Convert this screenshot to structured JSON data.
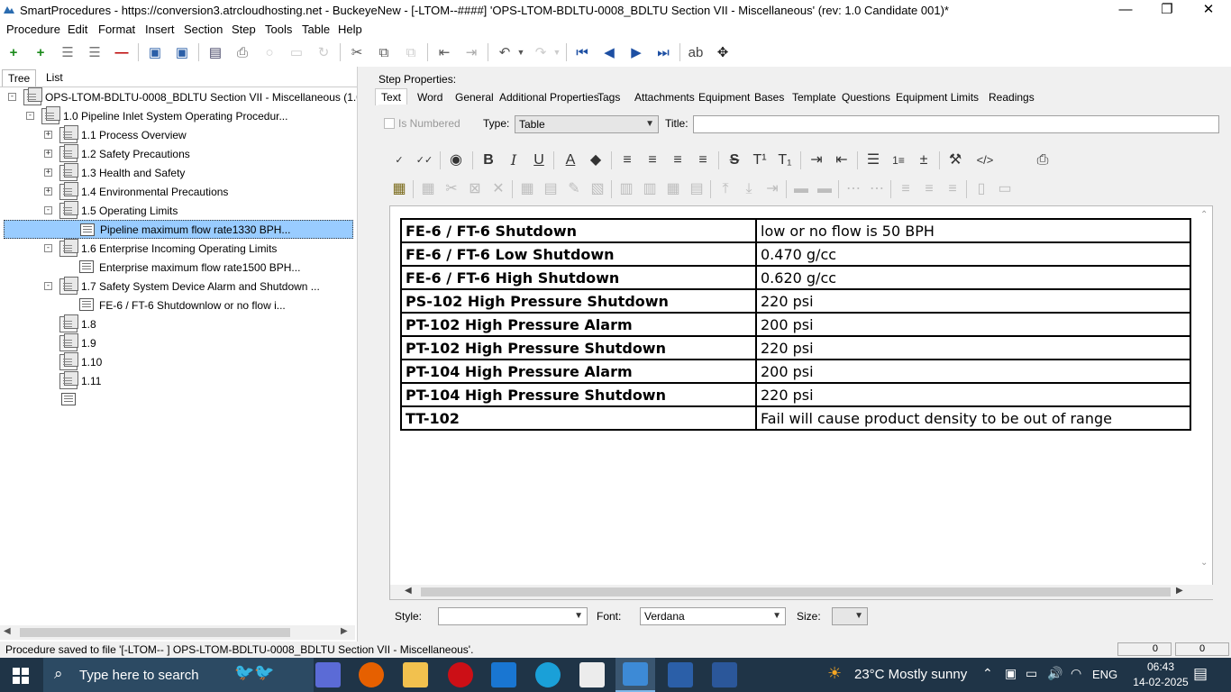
{
  "window": {
    "title": "SmartProcedures - https://conversion3.atrcloudhosting.net - BuckeyeNew - [-LTOM--####] 'OPS-LTOM-BDLTU-0008_BDLTU Section VII - Miscellaneous' (rev: 1.0 Candidate 001)*",
    "minimize": "—",
    "restore": "❐",
    "close": "✕"
  },
  "menu": {
    "procedure": "Procedure",
    "edit": "Edit",
    "format": "Format",
    "insert": "Insert",
    "section": "Section",
    "step": "Step",
    "tools": "Tools",
    "table": "Table",
    "help": "Help"
  },
  "left_tabs": {
    "tree": "Tree",
    "list": "List"
  },
  "tree": {
    "root": "OPS-LTOM-BDLTU-0008_BDLTU Section VII - Miscellaneous (1.0...",
    "s1": "1.0 Pipeline Inlet System Operating Procedur...",
    "s11": "1.1 Process Overview",
    "s12": "1.2 Safety Precautions",
    "s13": "1.3 Health and Safety",
    "s14": "1.4 Environmental Precautions",
    "s15": "1.5 Operating Limits",
    "s15a": "Pipeline maximum flow rate1330 BPH...",
    "s16": "1.6 Enterprise Incoming Operating Limits",
    "s16a": "Enterprise maximum flow rate1500 BPH...",
    "s17": "1.7 Safety System Device Alarm and Shutdown ...",
    "s17a": "FE-6 / FT-6 Shutdownlow or no flow i...",
    "s18": "1.8",
    "s19": "1.9",
    "s110": "1.10",
    "s111": "1.11"
  },
  "step_props": {
    "label": "Step Properties:",
    "tabs": [
      "Text",
      "Word",
      "General",
      "Additional Properties",
      "Tags",
      "Attachments",
      "Equipment",
      "Bases",
      "Template",
      "Questions",
      "Equipment Limits",
      "Readings"
    ],
    "is_numbered": "Is Numbered",
    "type_label": "Type:",
    "type_value": "Table",
    "title_label": "Title:",
    "title_value": ""
  },
  "table": {
    "rows": [
      [
        "FE-6 / FT-6 Shutdown",
        "low or no flow is 50 BPH"
      ],
      [
        "FE-6 / FT-6 Low Shutdown",
        "0.470 g/cc"
      ],
      [
        "FE-6 / FT-6 High Shutdown",
        "0.620 g/cc"
      ],
      [
        "PS-102 High Pressure Shutdown",
        "220 psi"
      ],
      [
        "PT-102 High Pressure Alarm",
        "200 psi"
      ],
      [
        "PT-102 High Pressure Shutdown",
        "220 psi"
      ],
      [
        "PT-104 High Pressure Alarm",
        "200 psi"
      ],
      [
        "PT-104 High Pressure Shutdown",
        "220 psi"
      ],
      [
        "TT-102",
        "Fail will cause product density to be out of range"
      ]
    ]
  },
  "bottom": {
    "style_label": "Style:",
    "style_value": "",
    "font_label": "Font:",
    "font_value": "Verdana",
    "size_label": "Size:",
    "size_value": ""
  },
  "status": {
    "message": "Procedure saved to file '[-LTOM--     ] OPS-LTOM-BDLTU-0008_BDLTU Section VII - Miscellaneous'.",
    "c1": "0",
    "c2": "0"
  },
  "taskbar": {
    "search_placeholder": "Type here to search",
    "weather": "23°C  Mostly sunny",
    "lang": "ENG",
    "time": "06:43",
    "date": "14-02-2025"
  },
  "colors": {
    "selection": "#99ccff",
    "taskbar": "#1f3447"
  }
}
